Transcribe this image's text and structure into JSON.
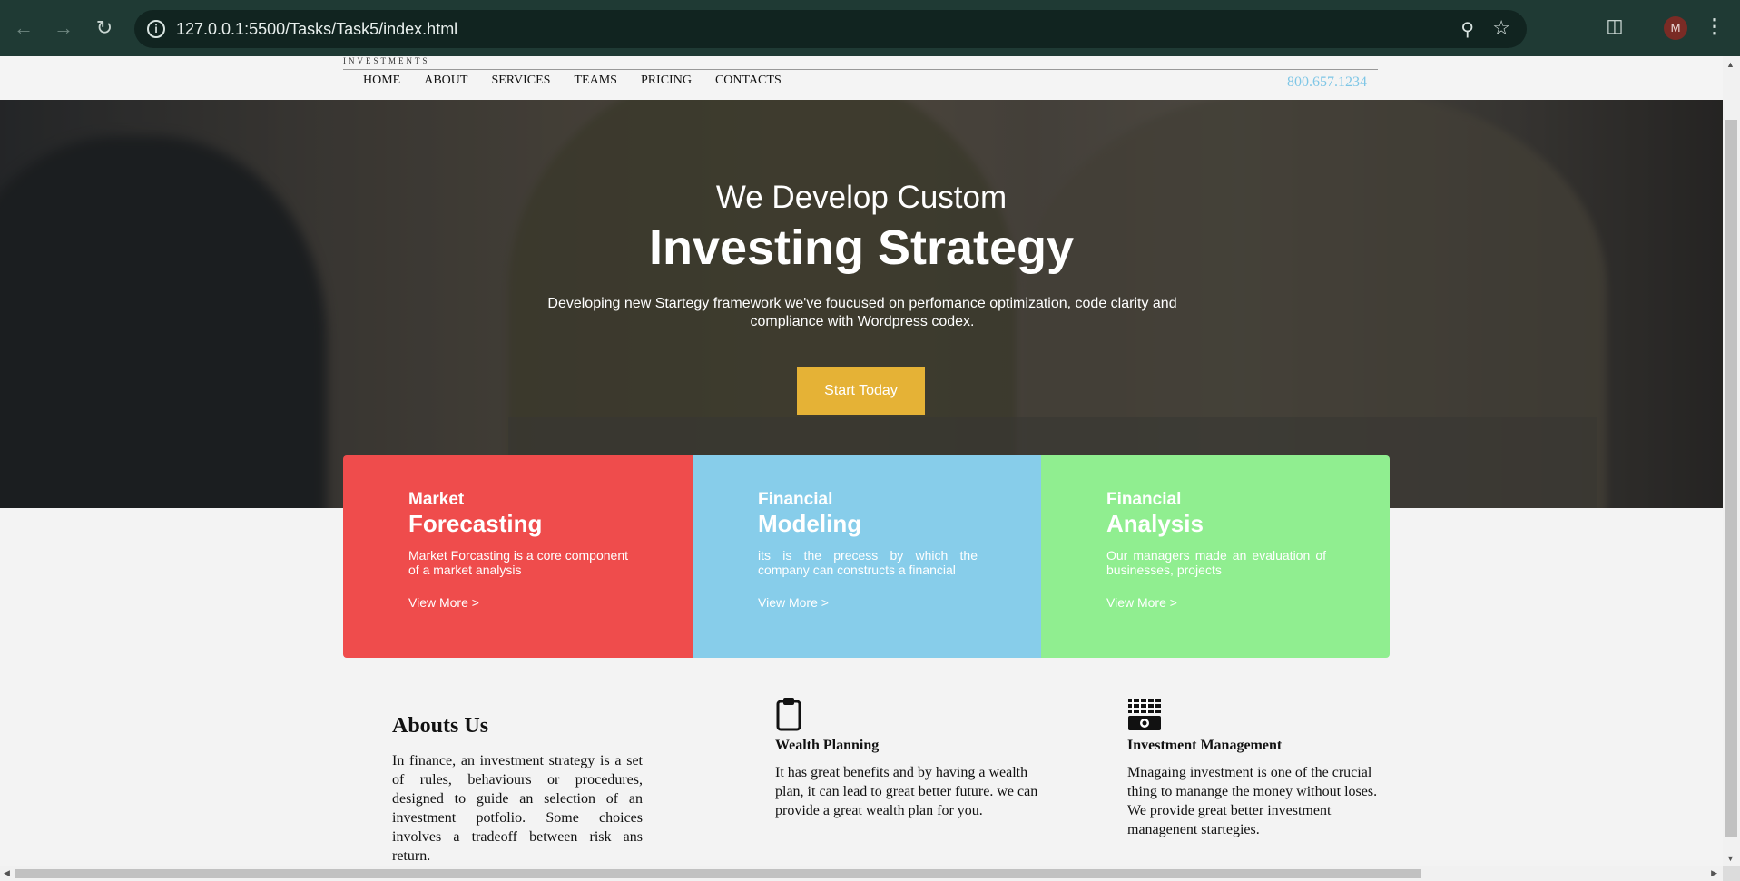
{
  "browser": {
    "url": "127.0.0.1:5500/Tasks/Task5/index.html",
    "avatar_letter": "M",
    "icons": [
      "back-icon",
      "forward-icon",
      "reload-icon",
      "info-icon",
      "zoom-icon",
      "star-icon",
      "extensions-icon",
      "menu-icon"
    ]
  },
  "header": {
    "logo_tagline": "INVESTMENTS",
    "nav": [
      "HOME",
      "ABOUT",
      "SERVICES",
      "TEAMS",
      "PRICING",
      "CONTACTS"
    ],
    "phone": "800.657.1234",
    "phone_color": "#7ec6e6"
  },
  "hero": {
    "subtitle": "We Develop Custom",
    "title": "Investing Strategy",
    "description": "Developing new Startegy framework we've foucused on perfomance optimization, code clarity and compliance with Wordpress codex.",
    "button": "Start Today",
    "button_color": "#e5b236"
  },
  "cards": [
    {
      "top": "Market",
      "main": "Forecasting",
      "desc": "Market Forcasting is a core component of a market analysis",
      "link": "View More >",
      "color": "#ef4c4c"
    },
    {
      "top": "Financial",
      "main": "Modeling",
      "desc": "its is the precess by which the company can constructs a financial",
      "link": "View More >",
      "color": "#87cdea"
    },
    {
      "top": "Financial",
      "main": "Analysis",
      "desc": "Our managers made an evaluation of businesses, projects",
      "link": "View More >",
      "color": "#90ee90"
    }
  ],
  "about": {
    "title": "Abouts Us",
    "text": "In finance, an investment strategy is a set of rules, behaviours or procedures, designed to guide an selection of an investment potfolio. Some choices involves a tradeoff between risk ans return."
  },
  "features": [
    {
      "icon": "clipboard-icon",
      "title": "Wealth Planning",
      "text": "It has great benefits and by having a wealth plan, it can lead to great better future. we can provide a great wealth plan for you."
    },
    {
      "icon": "money-stack-icon",
      "title": "Investment Management",
      "text": "Mnagaing investment is one of the crucial thing to manange the money without loses. We provide great better investment managenent startegies."
    }
  ]
}
